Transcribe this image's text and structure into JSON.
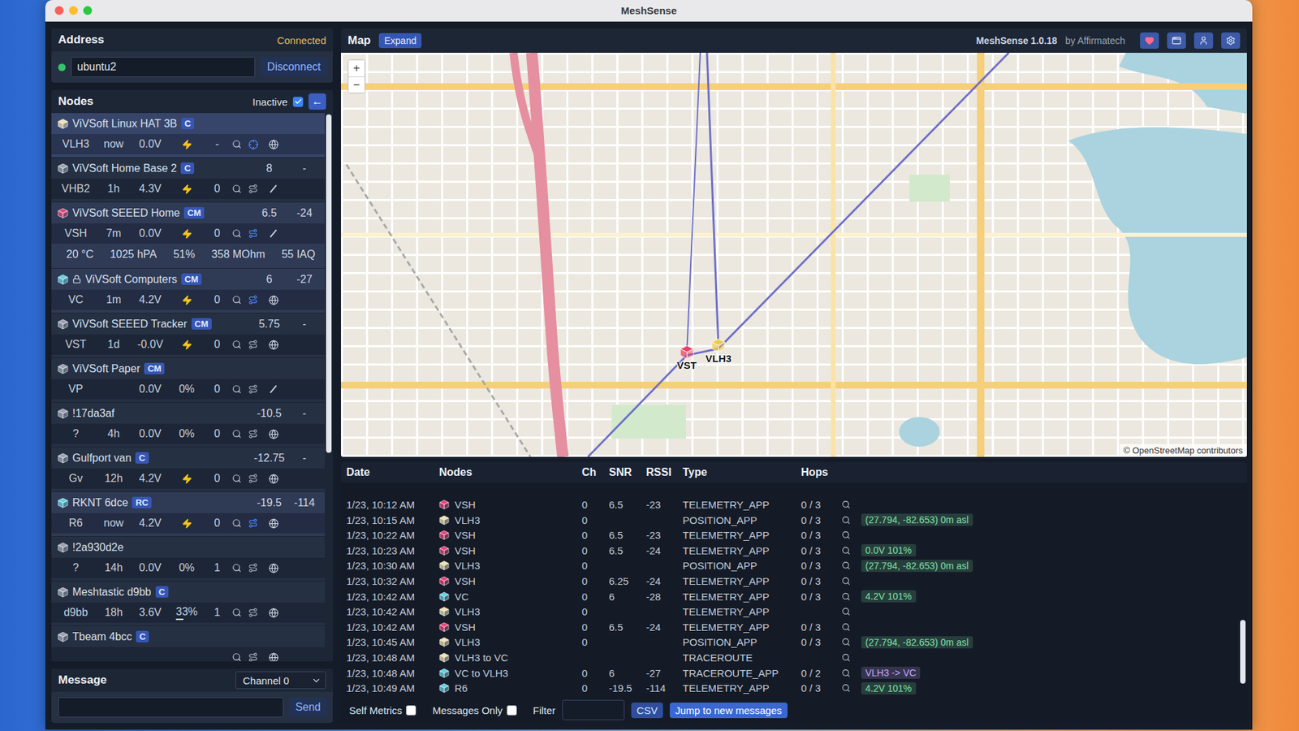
{
  "window": {
    "title": "MeshSense"
  },
  "address": {
    "title": "Address",
    "status": "Connected",
    "connected": true,
    "value": "ubuntu2",
    "button": "Disconnect"
  },
  "nodes": {
    "title": "Nodes",
    "inactive": {
      "label": "Inactive",
      "checked": true
    },
    "toggle": "←",
    "items": [
      {
        "name": "ViVSoft Linux HAT 3B",
        "badge": "C",
        "snr": "",
        "rssi": "",
        "color": "#efe3b0",
        "locked": false,
        "selected": true,
        "highlight": false,
        "short": "VLH3",
        "seen": "now",
        "voltage": "0.0V",
        "charging": true,
        "battery": "",
        "battery_level": 0,
        "hops": "-",
        "self": true,
        "trace_active": false,
        "position": "globe",
        "env": []
      },
      {
        "name": "ViVSoft Home Base 2",
        "badge": "C",
        "snr": "8",
        "rssi": "-",
        "color": "#9aa3b2",
        "locked": false,
        "selected": false,
        "highlight": false,
        "short": "VHB2",
        "seen": "1h",
        "voltage": "4.3V",
        "charging": true,
        "battery": "",
        "battery_level": 0,
        "hops": "0",
        "self": false,
        "trace_active": false,
        "position": "none",
        "env": []
      },
      {
        "name": "ViVSoft SEEED Home",
        "badge": "CM",
        "snr": "6.5",
        "rssi": "-24",
        "color": "#e8467c",
        "locked": false,
        "selected": false,
        "highlight": true,
        "short": "VSH",
        "seen": "7m",
        "voltage": "0.0V",
        "charging": true,
        "battery": "",
        "battery_level": 0,
        "hops": "0",
        "self": false,
        "trace_active": true,
        "position": "none",
        "env": [
          "20 °C",
          "1025 hPA",
          "51%",
          "358 MOhm",
          "55 IAQ"
        ]
      },
      {
        "name": "ViVSoft Computers",
        "badge": "CM",
        "snr": "6",
        "rssi": "-27",
        "color": "#5fd3e6",
        "locked": true,
        "selected": false,
        "highlight": true,
        "short": "VC",
        "seen": "1m",
        "voltage": "4.2V",
        "charging": true,
        "battery": "",
        "battery_level": 0,
        "hops": "0",
        "self": false,
        "trace_active": true,
        "position": "globe",
        "env": []
      },
      {
        "name": "ViVSoft SEEED Tracker",
        "badge": "CM",
        "snr": "5.75",
        "rssi": "-",
        "color": "#9aa3b2",
        "locked": false,
        "selected": false,
        "highlight": false,
        "short": "VST",
        "seen": "1d",
        "voltage": "-0.0V",
        "charging": true,
        "battery": "",
        "battery_level": 0,
        "hops": "0",
        "self": false,
        "trace_active": false,
        "position": "globe",
        "env": []
      },
      {
        "name": "ViVSoft Paper",
        "badge": "CM",
        "snr": "",
        "rssi": "",
        "color": "#9aa3b2",
        "locked": false,
        "selected": false,
        "highlight": false,
        "short": "VP",
        "seen": "",
        "voltage": "0.0V",
        "charging": false,
        "battery": "0%",
        "battery_level": 0,
        "hops": "0",
        "self": false,
        "trace_active": false,
        "position": "none",
        "env": []
      },
      {
        "name": "!17da3af",
        "badge": "",
        "snr": "-10.5",
        "rssi": "-",
        "color": "#9aa3b2",
        "locked": false,
        "selected": false,
        "highlight": false,
        "short": "?",
        "seen": "4h",
        "voltage": "0.0V",
        "charging": false,
        "battery": "0%",
        "battery_level": 0,
        "hops": "0",
        "self": false,
        "trace_active": false,
        "position": "globe",
        "env": []
      },
      {
        "name": "Gulfport van",
        "badge": "C",
        "snr": "-12.75",
        "rssi": "-",
        "color": "#9aa3b2",
        "locked": false,
        "selected": false,
        "highlight": false,
        "short": "Gv",
        "seen": "12h",
        "voltage": "4.2V",
        "charging": true,
        "battery": "",
        "battery_level": 0,
        "hops": "0",
        "self": false,
        "trace_active": false,
        "position": "globe",
        "env": []
      },
      {
        "name": "RKNT 6dce",
        "badge": "RC",
        "snr": "-19.5",
        "rssi": "-114",
        "color": "#5fd3e6",
        "locked": false,
        "selected": false,
        "highlight": true,
        "short": "R6",
        "seen": "now",
        "voltage": "4.2V",
        "charging": true,
        "battery": "",
        "battery_level": 0,
        "hops": "0",
        "self": false,
        "trace_active": true,
        "position": "globe",
        "env": []
      },
      {
        "name": "!2a930d2e",
        "badge": "",
        "snr": "",
        "rssi": "",
        "color": "#9aa3b2",
        "locked": false,
        "selected": false,
        "highlight": false,
        "short": "?",
        "seen": "14h",
        "voltage": "0.0V",
        "charging": false,
        "battery": "0%",
        "battery_level": 0,
        "hops": "1",
        "self": false,
        "trace_active": false,
        "position": "globe",
        "env": []
      },
      {
        "name": "Meshtastic d9bb",
        "badge": "C",
        "snr": "",
        "rssi": "",
        "color": "#9aa3b2",
        "locked": false,
        "selected": false,
        "highlight": false,
        "short": "d9bb",
        "seen": "18h",
        "voltage": "3.6V",
        "charging": false,
        "battery": "33%",
        "battery_level": 0.33,
        "hops": "1",
        "self": false,
        "trace_active": false,
        "position": "globe",
        "env": []
      },
      {
        "name": "Tbeam 4bcc",
        "badge": "C",
        "snr": "",
        "rssi": "",
        "color": "#9aa3b2",
        "locked": false,
        "selected": false,
        "highlight": false,
        "short": "",
        "seen": "",
        "voltage": "",
        "charging": false,
        "battery": "",
        "battery_level": 0,
        "hops": "",
        "self": false,
        "trace_active": false,
        "position": "globe",
        "env": []
      }
    ]
  },
  "message": {
    "title": "Message",
    "channel": "Channel 0",
    "value": "",
    "button": "Send"
  },
  "map": {
    "title": "Map",
    "expand": "Expand",
    "app": "MeshSense 1.0.18",
    "by": "by Affirmatech",
    "zoom_in": "+",
    "zoom_out": "−",
    "attribution": "© OpenStreetMap contributors",
    "pins": [
      {
        "label": "VST",
        "color": "#e8436a"
      },
      {
        "label": "VLH3",
        "color": "#f2c94c"
      }
    ]
  },
  "log": {
    "columns": [
      "Date",
      "Nodes",
      "Ch",
      "SNR",
      "RSSI",
      "Type",
      "Hops"
    ],
    "rows": [
      {
        "date": "1/23, 10:12 AM",
        "node": "VSH",
        "color": "#e8467c",
        "ch": "0",
        "snr": "6.5",
        "rssi": "-23",
        "type": "TELEMETRY_APP",
        "hops": "0 / 3",
        "detail": null
      },
      {
        "date": "1/23, 10:15 AM",
        "node": "VLH3",
        "color": "#efe3b0",
        "ch": "0",
        "snr": "",
        "rssi": "",
        "type": "POSITION_APP",
        "hops": "0 / 3",
        "detail": {
          "text": "(27.794, -82.653) 0m asl",
          "color": "#7ee0a4"
        }
      },
      {
        "date": "1/23, 10:22 AM",
        "node": "VSH",
        "color": "#e8467c",
        "ch": "0",
        "snr": "6.5",
        "rssi": "-23",
        "type": "TELEMETRY_APP",
        "hops": "0 / 3",
        "detail": null
      },
      {
        "date": "1/23, 10:23 AM",
        "node": "VSH",
        "color": "#e8467c",
        "ch": "0",
        "snr": "6.5",
        "rssi": "-24",
        "type": "TELEMETRY_APP",
        "hops": "0 / 3",
        "detail": {
          "text": "0.0V 101%",
          "color": "#7ee0a4"
        }
      },
      {
        "date": "1/23, 10:30 AM",
        "node": "VLH3",
        "color": "#efe3b0",
        "ch": "0",
        "snr": "",
        "rssi": "",
        "type": "POSITION_APP",
        "hops": "0 / 3",
        "detail": {
          "text": "(27.794, -82.653) 0m asl",
          "color": "#7ee0a4"
        }
      },
      {
        "date": "1/23, 10:32 AM",
        "node": "VSH",
        "color": "#e8467c",
        "ch": "0",
        "snr": "6.25",
        "rssi": "-24",
        "type": "TELEMETRY_APP",
        "hops": "0 / 3",
        "detail": null
      },
      {
        "date": "1/23, 10:42 AM",
        "node": "VC",
        "color": "#5fd3e6",
        "ch": "0",
        "snr": "6",
        "rssi": "-28",
        "type": "TELEMETRY_APP",
        "hops": "0 / 3",
        "detail": {
          "text": "4.2V 101%",
          "color": "#7ee0a4"
        }
      },
      {
        "date": "1/23, 10:42 AM",
        "node": "VLH3",
        "color": "#efe3b0",
        "ch": "0",
        "snr": "",
        "rssi": "",
        "type": "TELEMETRY_APP",
        "hops": "",
        "detail": null
      },
      {
        "date": "1/23, 10:42 AM",
        "node": "VSH",
        "color": "#e8467c",
        "ch": "0",
        "snr": "6.5",
        "rssi": "-24",
        "type": "TELEMETRY_APP",
        "hops": "0 / 3",
        "detail": null
      },
      {
        "date": "1/23, 10:45 AM",
        "node": "VLH3",
        "color": "#efe3b0",
        "ch": "0",
        "snr": "",
        "rssi": "",
        "type": "POSITION_APP",
        "hops": "0 / 3",
        "detail": {
          "text": "(27.794, -82.653) 0m asl",
          "color": "#7ee0a4"
        }
      },
      {
        "date": "1/23, 10:48 AM",
        "node": "VLH3 to VC",
        "color": "#efe3b0",
        "ch": "",
        "snr": "",
        "rssi": "",
        "type": "TRACEROUTE",
        "hops": "",
        "detail": null
      },
      {
        "date": "1/23, 10:48 AM",
        "node": "VC to VLH3",
        "color": "#5fd3e6",
        "ch": "0",
        "snr": "6",
        "rssi": "-27",
        "type": "TRACEROUTE_APP",
        "hops": "0 / 2",
        "detail": {
          "text": "VLH3 -> VC",
          "color": "#c9a6ff"
        }
      },
      {
        "date": "1/23, 10:49 AM",
        "node": "R6",
        "color": "#5fd3e6",
        "ch": "0",
        "snr": "-19.5",
        "rssi": "-114",
        "type": "TELEMETRY_APP",
        "hops": "0 / 3",
        "detail": {
          "text": "4.2V 101%",
          "color": "#7ee0a4"
        }
      }
    ]
  },
  "toolbar": {
    "self_metrics": {
      "label": "Self Metrics",
      "checked": false
    },
    "messages_only": {
      "label": "Messages Only",
      "checked": false
    },
    "filter": {
      "label": "Filter",
      "value": ""
    },
    "csv": "CSV",
    "jump": "Jump to new messages"
  }
}
